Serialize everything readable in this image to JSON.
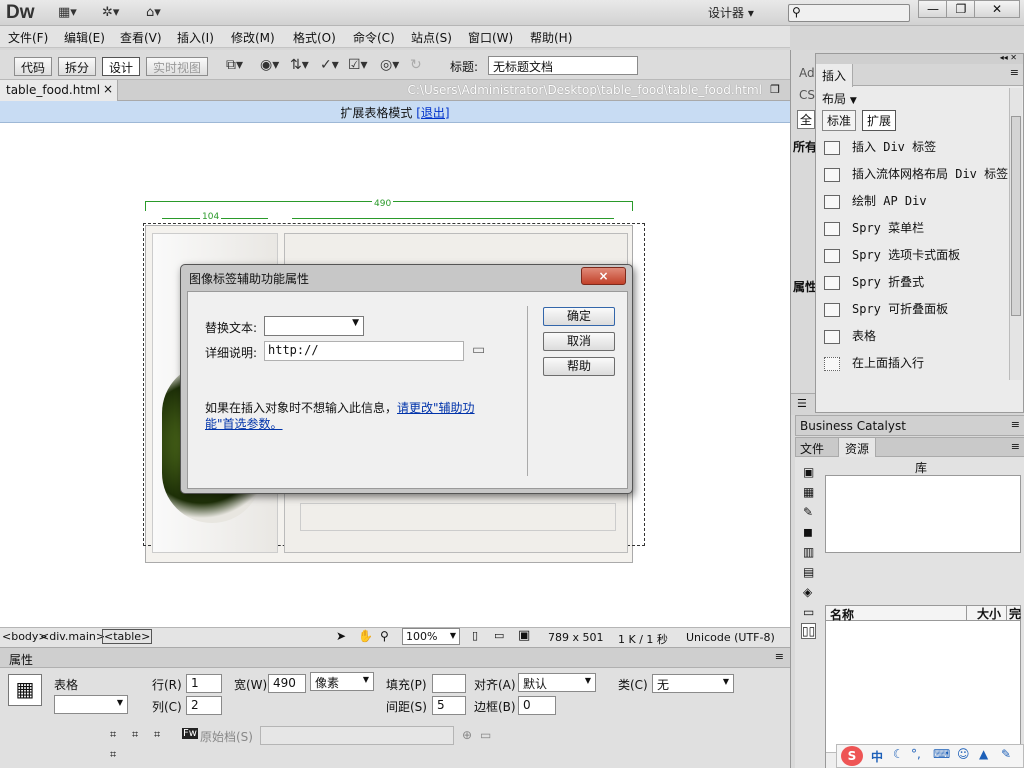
{
  "app": {
    "logo": "Dw",
    "workspace": "设计器 ▾"
  },
  "menu": [
    "文件(F)",
    "编辑(E)",
    "查看(V)",
    "插入(I)",
    "修改(M)",
    "格式(O)",
    "命令(C)",
    "站点(S)",
    "窗口(W)",
    "帮助(H)"
  ],
  "toolbar": {
    "views": [
      "代码",
      "拆分",
      "设计",
      "实时视图"
    ],
    "title_label": "标题:",
    "title_value": "无标题文档"
  },
  "tab": {
    "filename": "table_food.html",
    "close": "×",
    "path": "C:\\Users\\Administrator\\Desktop\\table_food\\table_food.html"
  },
  "expanded": {
    "text": "扩展表格模式 ",
    "exit": "[退出]"
  },
  "design": {
    "width_total": "490",
    "width_col": "104"
  },
  "dialog": {
    "title": "图像标签辅助功能属性",
    "close": "×",
    "alt_label": "替换文本:",
    "alt_value": "",
    "long_desc_label": "详细说明:",
    "long_desc_value": "http://",
    "note": "如果在插入对象时不想输入此信息，",
    "note_link": "请更改\"辅助功能\"首选参数。",
    "ok": "确定",
    "cancel": "取消",
    "help": "帮助"
  },
  "status": {
    "tags": [
      "<body>",
      "<div.main>",
      "<table>"
    ],
    "zoom": "100%",
    "size": "789 x 501",
    "info": "1 K / 1 秒",
    "encoding": "Unicode (UTF-8)"
  },
  "properties": {
    "header": "属性",
    "element": "表格",
    "rows_label": "行(R)",
    "rows": "1",
    "cols_label": "列(C)",
    "cols": "2",
    "width_label": "宽(W)",
    "width": "490",
    "width_unit": "像素",
    "padding_label": "填充(P)",
    "padding": "",
    "spacing_label": "间距(S)",
    "spacing": "5",
    "align_label": "对齐(A)",
    "align": "默认",
    "border_label": "边框(B)",
    "border": "0",
    "class_label": "类(C)",
    "class": "无",
    "source_label": "原始档(S)"
  },
  "insert_panel": {
    "tab": "插入",
    "category": "布局",
    "modes": [
      "标准",
      "扩展"
    ],
    "items": [
      "插入 Div 标签",
      "插入流体网格布局 Div 标签",
      "绘制 AP Div",
      "Spry 菜单栏",
      "Spry 选项卡式面板",
      "Spry 折叠式",
      "Spry 可折叠面板",
      "表格",
      "在上面插入行"
    ]
  },
  "side_tabs": {
    "ad": "Ad",
    "cs": "CS",
    "all": "全",
    "so": "所有",
    "attr": "属性"
  },
  "bc": {
    "title": "Business Catalyst"
  },
  "files": {
    "tabs": [
      "文件",
      "资源"
    ],
    "library": "库",
    "col_name": "名称",
    "col_size": "大小",
    "col_full": "完"
  },
  "ime": {
    "label": "中"
  }
}
